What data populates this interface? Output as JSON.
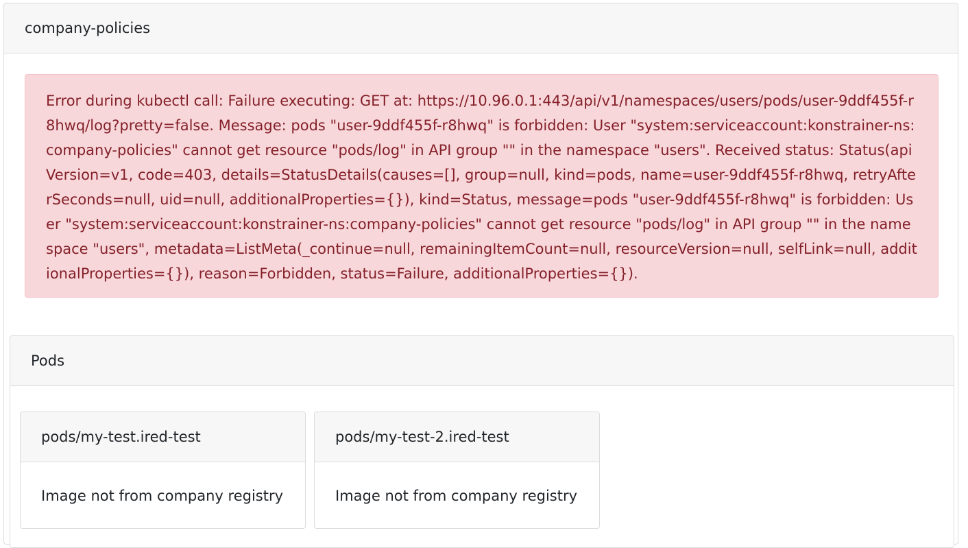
{
  "policy": {
    "title": "company-policies"
  },
  "error": {
    "message": "Error during kubectl call: Failure executing: GET at: https://10.96.0.1:443/api/v1/namespaces/users/pods/user-9ddf455f-r8hwq/log?pretty=false. Message: pods \"user-9ddf455f-r8hwq\" is forbidden: User \"system:serviceaccount:konstrainer-ns:company-policies\" cannot get resource \"pods/log\" in API group \"\" in the namespace \"users\". Received status: Status(apiVersion=v1, code=403, details=StatusDetails(causes=[], group=null, kind=pods, name=user-9ddf455f-r8hwq, retryAfterSeconds=null, uid=null, additionalProperties={}), kind=Status, message=pods \"user-9ddf455f-r8hwq\" is forbidden: User \"system:serviceaccount:konstrainer-ns:company-policies\" cannot get resource \"pods/log\" in API group \"\" in the namespace \"users\", metadata=ListMeta(_continue=null, remainingItemCount=null, resourceVersion=null, selfLink=null, additionalProperties={}), reason=Forbidden, status=Failure, additionalProperties={})."
  },
  "pods": {
    "title": "Pods",
    "items": [
      {
        "name": "pods/my-test.ired-test",
        "message": "Image not from company registry"
      },
      {
        "name": "pods/my-test-2.ired-test",
        "message": "Image not from company registry"
      }
    ]
  }
}
